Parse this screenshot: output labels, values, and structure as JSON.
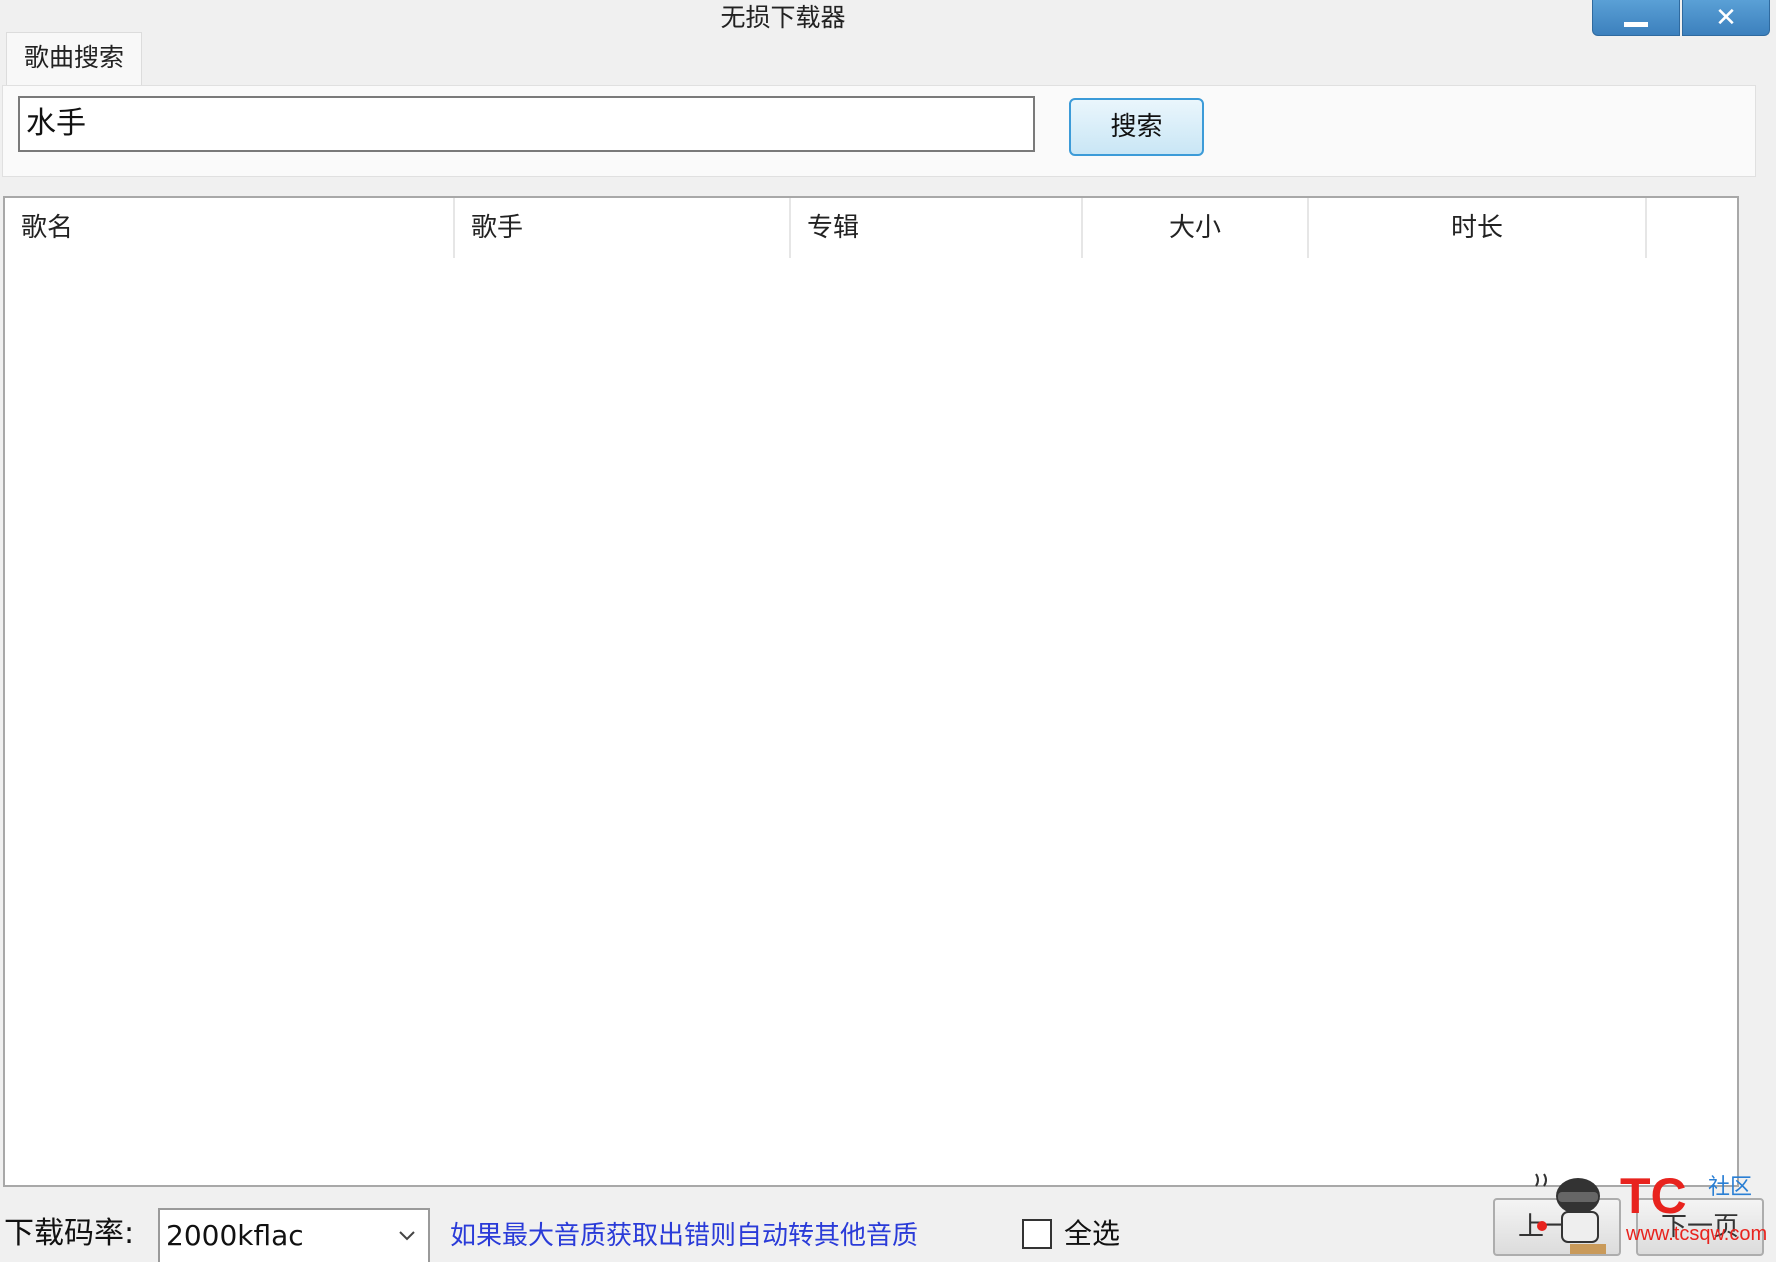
{
  "window": {
    "title": "无损下载器",
    "minimize_icon": "minimize-icon",
    "close_icon": "close-icon"
  },
  "tabs": [
    {
      "label": "歌曲搜索",
      "active": true
    }
  ],
  "search": {
    "value": "水手",
    "button_label": "搜索"
  },
  "table": {
    "columns": [
      "歌名",
      "歌手",
      "专辑",
      "大小",
      "时长"
    ],
    "rows": []
  },
  "bottom": {
    "rate_label": "下载码率:",
    "rate_value": "2000kflac",
    "hint": "如果最大音质获取出错则自动转其他音质",
    "select_all_label": "全选",
    "select_all_checked": false,
    "prev_label": "上一页",
    "next_label": "下一页"
  },
  "watermark": {
    "brand": "TC",
    "community": "社区",
    "url": "www.tcsqw.com"
  },
  "colors": {
    "hint_text": "#2a3bd8",
    "titlebar_button": "#4a8fcb",
    "search_button_border": "#3c9bd8",
    "watermark_red": "#e8231e"
  }
}
